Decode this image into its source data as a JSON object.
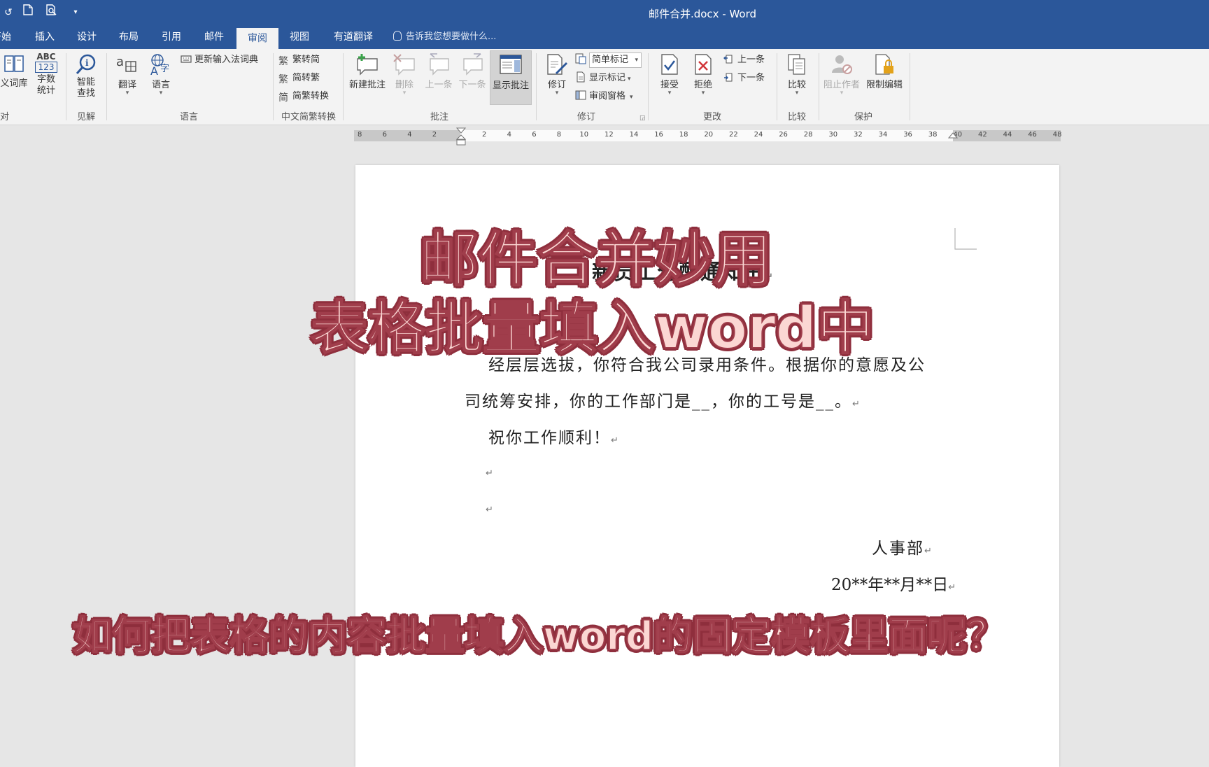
{
  "window": {
    "title": "邮件合并.docx - Word"
  },
  "tabs": [
    {
      "label": "开始"
    },
    {
      "label": "插入"
    },
    {
      "label": "设计"
    },
    {
      "label": "布局"
    },
    {
      "label": "引用"
    },
    {
      "label": "邮件"
    },
    {
      "label": "审阅",
      "active": true
    },
    {
      "label": "视图"
    },
    {
      "label": "有道翻译"
    }
  ],
  "tell_me": "告诉我您想要做什么...",
  "ribbon": {
    "proofing": {
      "thesaurus": "义词库",
      "word_count_1": "字数",
      "word_count_2": "统计",
      "label": "对",
      "abc": "ABC",
      "num": "123"
    },
    "insights": {
      "smart_lookup_1": "智能",
      "smart_lookup_2": "查找",
      "label": "见解"
    },
    "language": {
      "translate": "翻译",
      "language": "语言",
      "update_ime": "更新输入法词典",
      "label": "语言"
    },
    "chinese_conversion": {
      "to_simplified": "繁转简",
      "to_traditional": "简转繁",
      "convert": "简繁转换",
      "label": "中文简繁转换"
    },
    "comments": {
      "new": "新建批注",
      "delete": "删除",
      "previous": "上一条",
      "next": "下一条",
      "show": "显示批注",
      "label": "批注"
    },
    "tracking": {
      "track": "修订",
      "simple_markup": "简单标记",
      "show_markup": "显示标记",
      "reviewing_pane": "审阅窗格",
      "label": "修订"
    },
    "changes": {
      "accept": "接受",
      "reject": "拒绝",
      "previous": "上一条",
      "next": "下一条",
      "label": "更改"
    },
    "compare": {
      "compare": "比较",
      "label": "比较"
    },
    "protect": {
      "block_authors": "阻止作者",
      "restrict_editing": "限制编辑",
      "label": "保护"
    }
  },
  "ruler": {
    "labels": [
      "8",
      "6",
      "4",
      "2",
      "",
      "2",
      "4",
      "6",
      "8",
      "10",
      "12",
      "14",
      "16",
      "18",
      "20",
      "22",
      "24",
      "26",
      "28",
      "30",
      "32",
      "34",
      "36",
      "38",
      "40",
      "42",
      "44",
      "46",
      "48"
    ]
  },
  "document": {
    "title": "新员工分配通知书",
    "para1": "经层层选拔，你符合我公司录用条件。根据你的意愿及公",
    "para2": "司统筹安排，你的工作部门是__，你的工号是__。",
    "para3": "祝你工作顺利！",
    "dept": "人事部",
    "date": "20**年**月**日",
    "para_mark": "↵"
  },
  "overlay": {
    "title_line1": "邮件合并妙用",
    "title_line2": "表格批量填入word中",
    "question": "如何把表格的内容批量填入word的固定模板里面呢？"
  },
  "colors": {
    "word_blue": "#2b579a",
    "overlay_fill": "#fbd7d3",
    "overlay_stroke": "#8f2f3d"
  }
}
